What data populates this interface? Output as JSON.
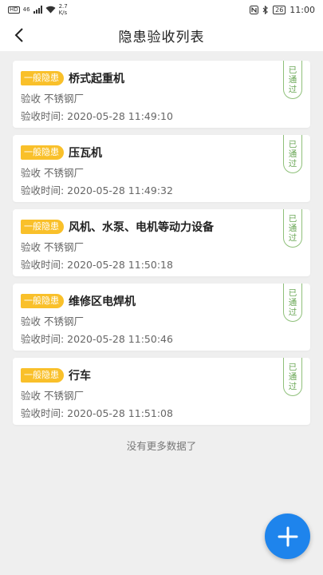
{
  "status_bar": {
    "left_text": "46",
    "speed_value": "2.7",
    "speed_unit": "K/s",
    "battery": "26",
    "time": "11:00"
  },
  "header": {
    "title": "隐患验收列表"
  },
  "stamp": [
    "已",
    "通",
    "过"
  ],
  "items": [
    {
      "badge": "一般隐患",
      "title": "桥式起重机",
      "line1": "验收 不锈钢厂",
      "line2": "验收时间: 2020-05-28 11:49:10"
    },
    {
      "badge": "一般隐患",
      "title": "压瓦机",
      "line1": "验收 不锈钢厂",
      "line2": "验收时间: 2020-05-28 11:49:32"
    },
    {
      "badge": "一般隐患",
      "title": "风机、水泵、电机等动力设备",
      "line1": "验收 不锈钢厂",
      "line2": "验收时间: 2020-05-28 11:50:18"
    },
    {
      "badge": "一般隐患",
      "title": "维修区电焊机",
      "line1": "验收 不锈钢厂",
      "line2": "验收时间: 2020-05-28 11:50:46"
    },
    {
      "badge": "一般隐患",
      "title": "行车",
      "line1": "验收 不锈钢厂",
      "line2": "验收时间: 2020-05-28 11:51:08"
    }
  ],
  "footer": {
    "no_more": "没有更多数据了"
  },
  "colors": {
    "badge": "#f9c02a",
    "stamp": "#6aa756",
    "fab": "#1e84ec"
  },
  "icons": {
    "back": "chevron-left-icon",
    "fab": "plus-icon"
  }
}
